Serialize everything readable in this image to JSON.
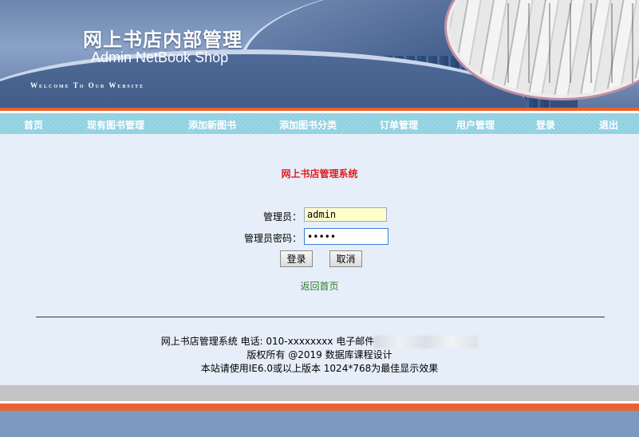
{
  "header": {
    "title": "网上书店内部管理",
    "subtitle": "Admin NetBook Shop",
    "welcome": "Welcome To Our Website"
  },
  "nav": {
    "items": [
      {
        "label": "首页"
      },
      {
        "label": "现有图书管理"
      },
      {
        "label": "添加新图书"
      },
      {
        "label": "添加图书分类"
      },
      {
        "label": "订单管理"
      },
      {
        "label": "用户管理"
      },
      {
        "label": "登录"
      },
      {
        "label": "退出"
      }
    ]
  },
  "login": {
    "heading": "网上书店管理系统",
    "username_label": "管理员：",
    "username_value": "admin",
    "password_label": "管理员密码：",
    "password_value": "•••••",
    "submit_label": "登录",
    "cancel_label": "取消",
    "back_link": "返回首页"
  },
  "footer": {
    "line1": "网上书店管理系统 电话: 010-xxxxxxxx 电子邮件",
    "line2": "版权所有 @2019 数据库课程设计",
    "line3": "本站请使用IE6.0或以上版本 1024*768为最佳显示效果"
  }
}
